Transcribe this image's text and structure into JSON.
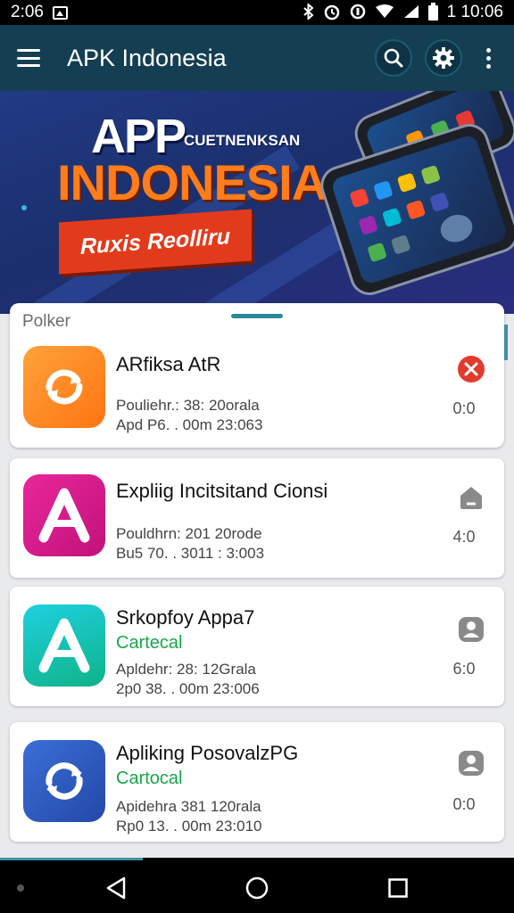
{
  "status_bar": {
    "time": "2:06",
    "clock_right": "1 10:06"
  },
  "app_bar": {
    "title": "APK Indonesia",
    "icons": [
      "hamburger-menu-icon",
      "search-icon",
      "gear-icon",
      "more-vert-icon"
    ]
  },
  "banner": {
    "line1": "APP",
    "line1_sub": "CUETNENKSAN",
    "line2": "INDONESIA",
    "ribbon": "Ruxis Reolliru"
  },
  "sheet": {
    "label": "Polker"
  },
  "apps": [
    {
      "name": "ARfiksa AtR",
      "category": "",
      "meta1": "Pouliehr.: 38: 20orala",
      "meta2": "Apd P6. . 00m 23:063",
      "size": "0:0",
      "action_icon": "cancel-icon",
      "icon_color": "#ff8a1e"
    },
    {
      "name": "Expliig Incitsitand Cionsi",
      "category": "",
      "meta1": "Pouldhrn: 201 20rode",
      "meta2": "Bu5 70. . 3011 : 3:003",
      "size": "4:0",
      "action_icon": "house-icon",
      "icon_color": "#d81f8f"
    },
    {
      "name": "Srkopfoy Appa7",
      "category": "Cartecal",
      "meta1": "Apldehr: 28: 12Grala",
      "meta2": "2p0 38. . 00m 23:006",
      "size": "6:0",
      "action_icon": "person-icon",
      "icon_color": "#18c0c8"
    },
    {
      "name": "Apliking PosovalzPG",
      "category": "Cartocal",
      "meta1": "Apidehra 381 120rala",
      "meta2": "Rp0 13. . 00m 23:010",
      "size": "0:0",
      "action_icon": "person-icon",
      "icon_color": "#2f5fc4"
    }
  ],
  "nav_bar": {
    "icons": [
      "back-icon",
      "home-icon",
      "recents-icon"
    ]
  }
}
